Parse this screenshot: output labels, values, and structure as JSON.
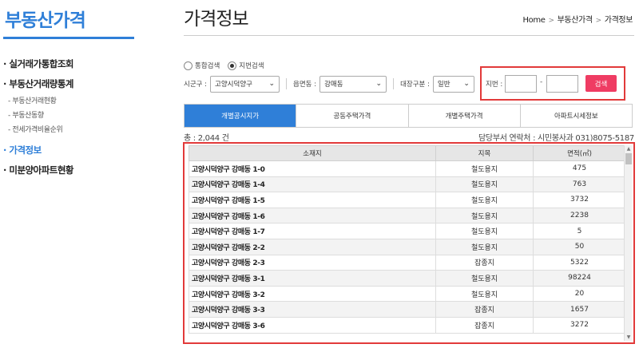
{
  "sidebar": {
    "title": "부동산가격",
    "items": [
      {
        "label": "실거래가통합조회"
      },
      {
        "label": "부동산거래량통계"
      },
      {
        "label": "가격정보"
      },
      {
        "label": "미분양아파트현황"
      }
    ],
    "subitems": [
      {
        "label": "부동산거래현황"
      },
      {
        "label": "부동산동향"
      },
      {
        "label": "전세가격비율순위"
      }
    ]
  },
  "header": {
    "title": "가격정보",
    "breadcrumb": [
      "Home",
      "부동산가격",
      "가격정보"
    ]
  },
  "search": {
    "radio_integrated": "통합검색",
    "radio_jibun": "지번검색",
    "sigungu_label": "시군구 :",
    "sigungu_value": "고양시덕양구",
    "eupmyeondong_label": "읍면동 :",
    "eupmyeondong_value": "강매동",
    "daejang_label": "대장구분 :",
    "daejang_value": "일반",
    "jibun_label": "지번 :",
    "jibun_dash": "-",
    "search_button": "검색"
  },
  "tabs": [
    {
      "label": "개별공시지가"
    },
    {
      "label": "공동주택가격"
    },
    {
      "label": "개별주택가격"
    },
    {
      "label": "아파트시세정보"
    }
  ],
  "info": {
    "total": "총 : 2,044 건",
    "contact": "담당부서 연락처 : 시민봉사과 031)8075-5187"
  },
  "table": {
    "headers": [
      "소재지",
      "지목",
      "면적(㎡)"
    ],
    "rows": [
      [
        "고양시덕양구 강매동 1-0",
        "철도용지",
        "475"
      ],
      [
        "고양시덕양구 강매동 1-4",
        "철도용지",
        "763"
      ],
      [
        "고양시덕양구 강매동 1-5",
        "철도용지",
        "3732"
      ],
      [
        "고양시덕양구 강매동 1-6",
        "철도용지",
        "2238"
      ],
      [
        "고양시덕양구 강매동 1-7",
        "철도용지",
        "5"
      ],
      [
        "고양시덕양구 강매동 2-2",
        "철도용지",
        "50"
      ],
      [
        "고양시덕양구 강매동 2-3",
        "잡종지",
        "5322"
      ],
      [
        "고양시덕양구 강매동 3-1",
        "철도용지",
        "98224"
      ],
      [
        "고양시덕양구 강매동 3-2",
        "철도용지",
        "20"
      ],
      [
        "고양시덕양구 강매동 3-3",
        "잡종지",
        "1657"
      ],
      [
        "고양시덕양구 강매동 3-6",
        "잡종지",
        "3272"
      ]
    ]
  },
  "colors": {
    "accent": "#2f7fd8",
    "highlight_border": "#e23a3a",
    "search_button": "#ef3c63"
  }
}
